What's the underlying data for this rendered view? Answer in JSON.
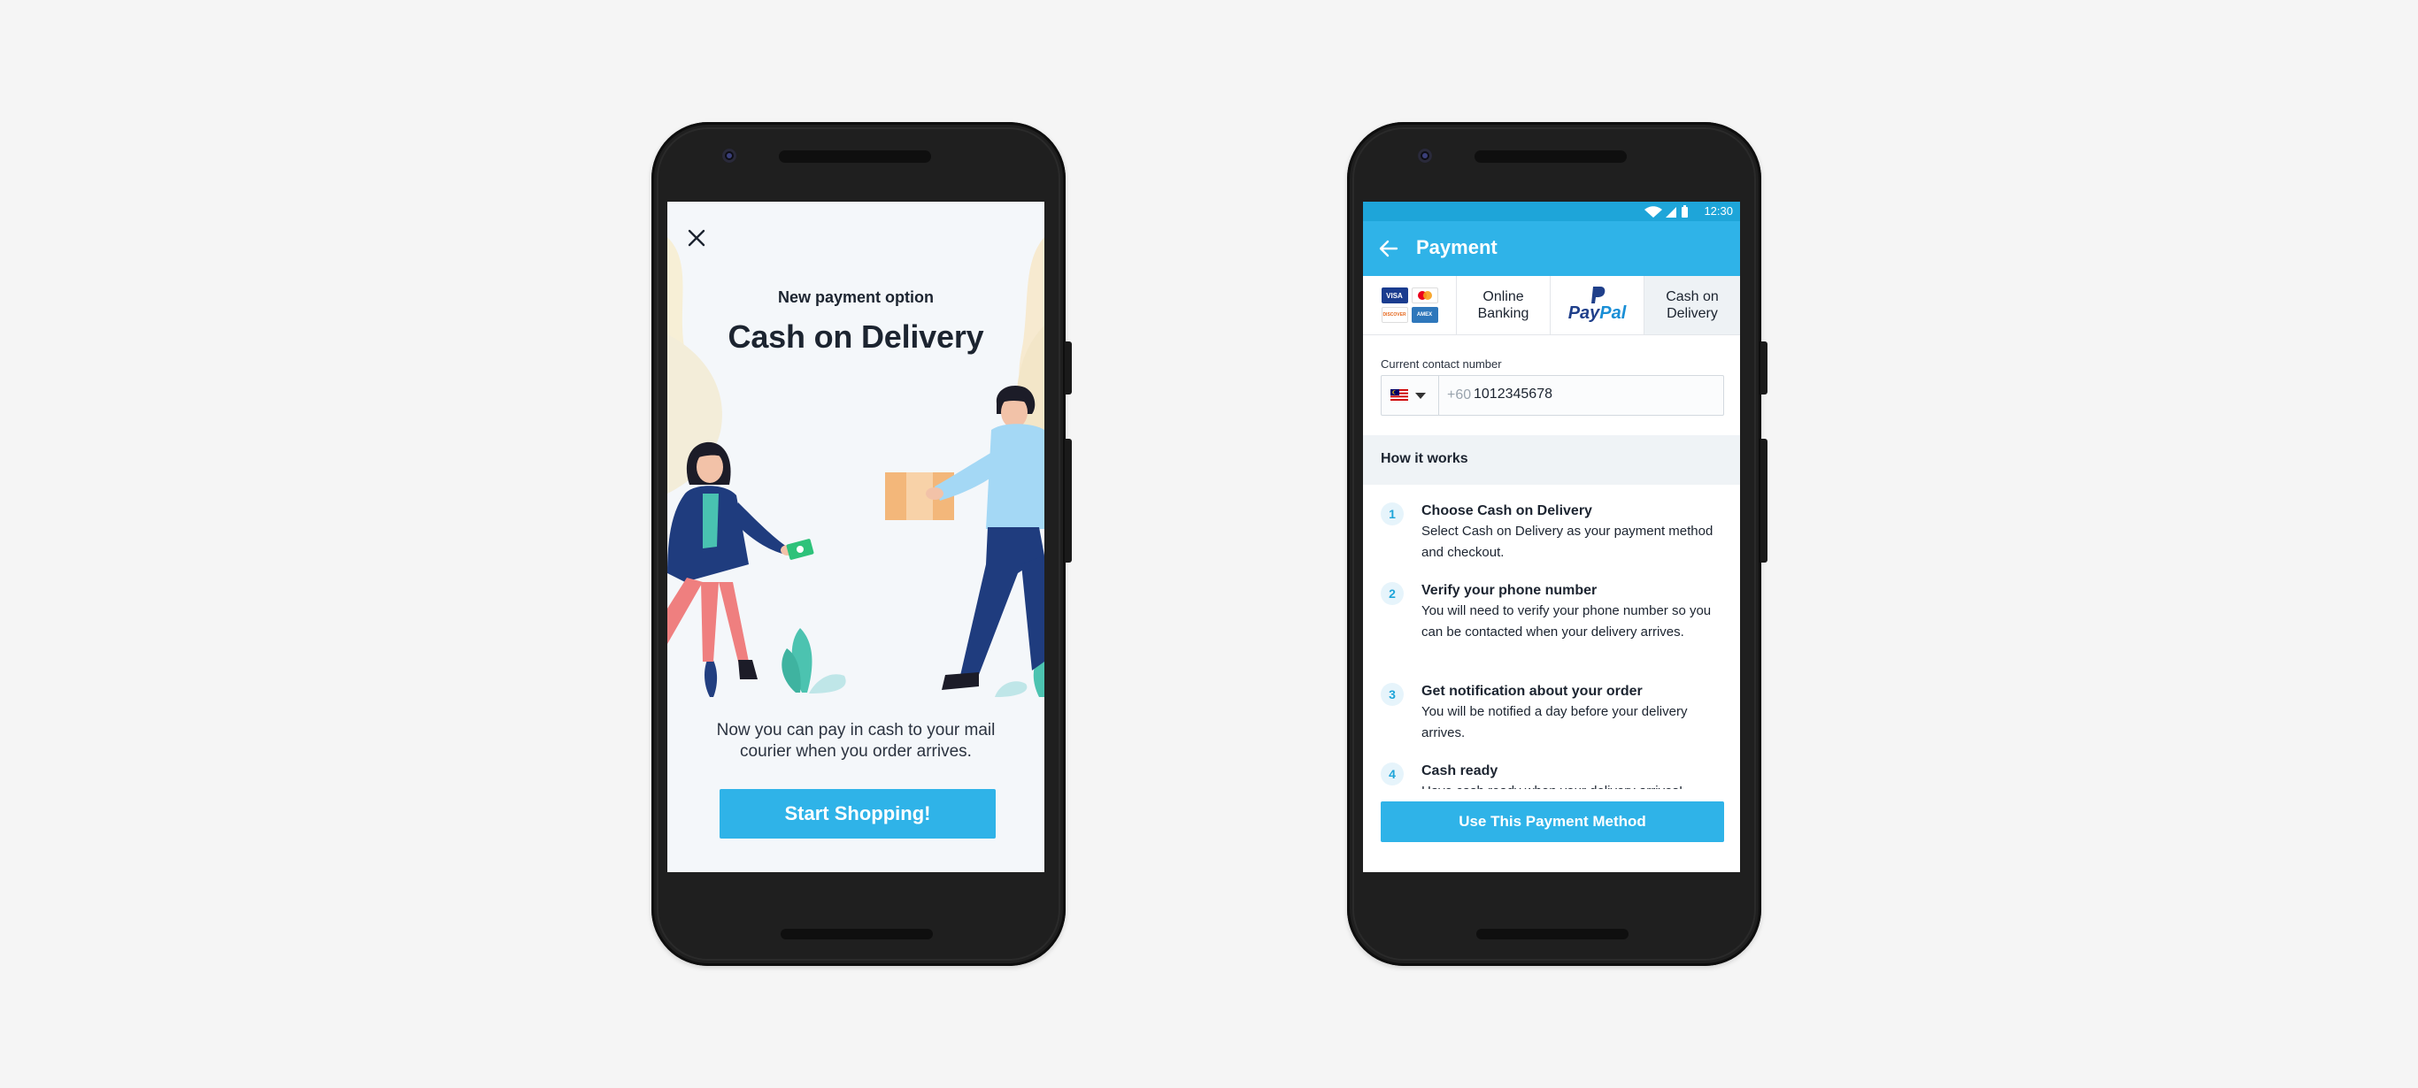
{
  "left_screen": {
    "subtitle": "New payment option",
    "title": "Cash on Delivery",
    "description": "Now you can pay in cash to your mail courier when you order arrives.",
    "start_button": "Start Shopping!",
    "close_icon": "close-icon"
  },
  "right_screen": {
    "status_bar": {
      "time": "12:30",
      "icons": [
        "wifi-icon",
        "signal-icon",
        "battery-icon"
      ]
    },
    "app_bar": {
      "title": "Payment",
      "back_icon": "arrow-left-icon"
    },
    "tabs": [
      {
        "label": "",
        "icon": "credit-cards-icon",
        "cards": [
          "VISA",
          "MC",
          "DISCOVER",
          "AMEX"
        ]
      },
      {
        "label": "Online Banking"
      },
      {
        "label": "",
        "logo": {
          "pay": "Pay",
          "pal": "Pal"
        }
      },
      {
        "label": "Cash on Delivery",
        "selected": true
      }
    ],
    "contact": {
      "label": "Current contact number",
      "country_flag": "malaysia-flag-icon",
      "prefix": "+60",
      "value": "1012345678"
    },
    "how_it_works": {
      "header": "How it works",
      "steps": [
        {
          "num": "1",
          "title": "Choose Cash on Delivery",
          "desc": "Select Cash on Delivery as your payment method and checkout."
        },
        {
          "num": "2",
          "title": "Verify your phone number",
          "desc": "You will need to verify your phone number so you can be contacted when your delivery arrives."
        },
        {
          "num": "3",
          "title": "Get notification about your order",
          "desc": "You will be notified a day before your delivery arrives."
        },
        {
          "num": "4",
          "title": "Cash ready",
          "desc": "Have cash ready when your delivery arrives!"
        }
      ]
    },
    "use_button": "Use This Payment Method"
  },
  "colors": {
    "background": "#f5f5f5",
    "phone_body": "#1f1f1f",
    "accent": "#2fb3e8",
    "status_bar": "#1ea5d9",
    "text_dark": "#1c2430",
    "muted_panel": "#eff3f6"
  }
}
